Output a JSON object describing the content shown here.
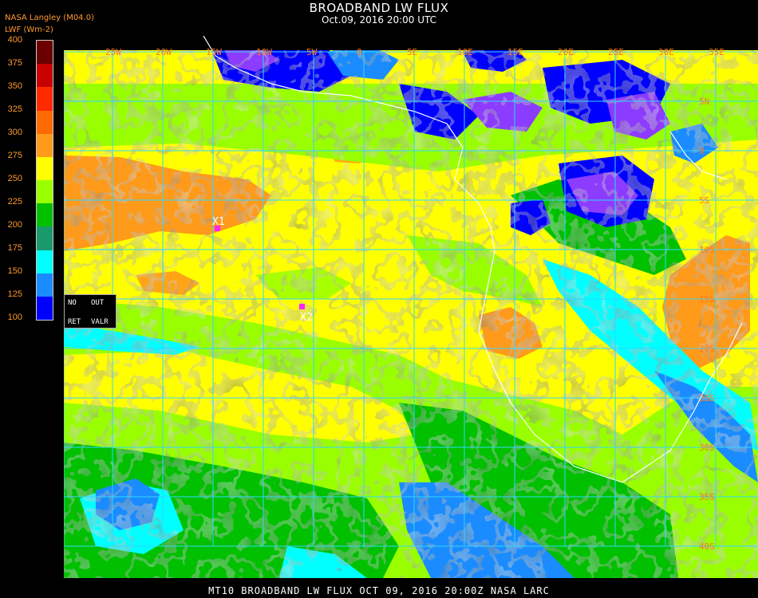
{
  "header": {
    "title": "BROADBAND LW FLUX",
    "subtitle": "Oct.09, 2016 20:00 UTC",
    "org_line": "NASA Langley (M04.0)",
    "units": "LWF (Wm-2)"
  },
  "legend": {
    "labels": [
      "400",
      "375",
      "350",
      "325",
      "300",
      "275",
      "250",
      "225",
      "200",
      "175",
      "150",
      "125",
      "100"
    ],
    "colors": [
      "#6b0000",
      "#c80000",
      "#ff2a00",
      "#ff6a00",
      "#ff9a1a",
      "#ffff00",
      "#99ff00",
      "#00c000",
      "#1a9a6a",
      "#00ffff",
      "#1a8cff",
      "#0000ff",
      "#8c3cff"
    ]
  },
  "panel": {
    "no": "NO",
    "out": "OUT",
    "ret": "RET",
    "valr": "VALR"
  },
  "map": {
    "lon_labels": [
      "25W",
      "20W",
      "15W",
      "10W",
      "5W",
      "0",
      "5E",
      "10E",
      "15E",
      "20E",
      "25E",
      "30E",
      "35E"
    ],
    "lat_labels": [
      "5N",
      "0",
      "5S",
      "10S",
      "15S",
      "20S",
      "25S",
      "30S",
      "35S",
      "40S"
    ],
    "markers": [
      {
        "label": "X1",
        "color": "#ff22ff"
      },
      {
        "label": "X2",
        "color": "#ff22ff"
      }
    ],
    "grid_color": "#33d6ff",
    "coast_color": "#ffffff"
  },
  "footer": {
    "text": "MT10  BROADBAND LW FLUX   OCT 09, 2016 20:00Z   NASA LARC"
  }
}
